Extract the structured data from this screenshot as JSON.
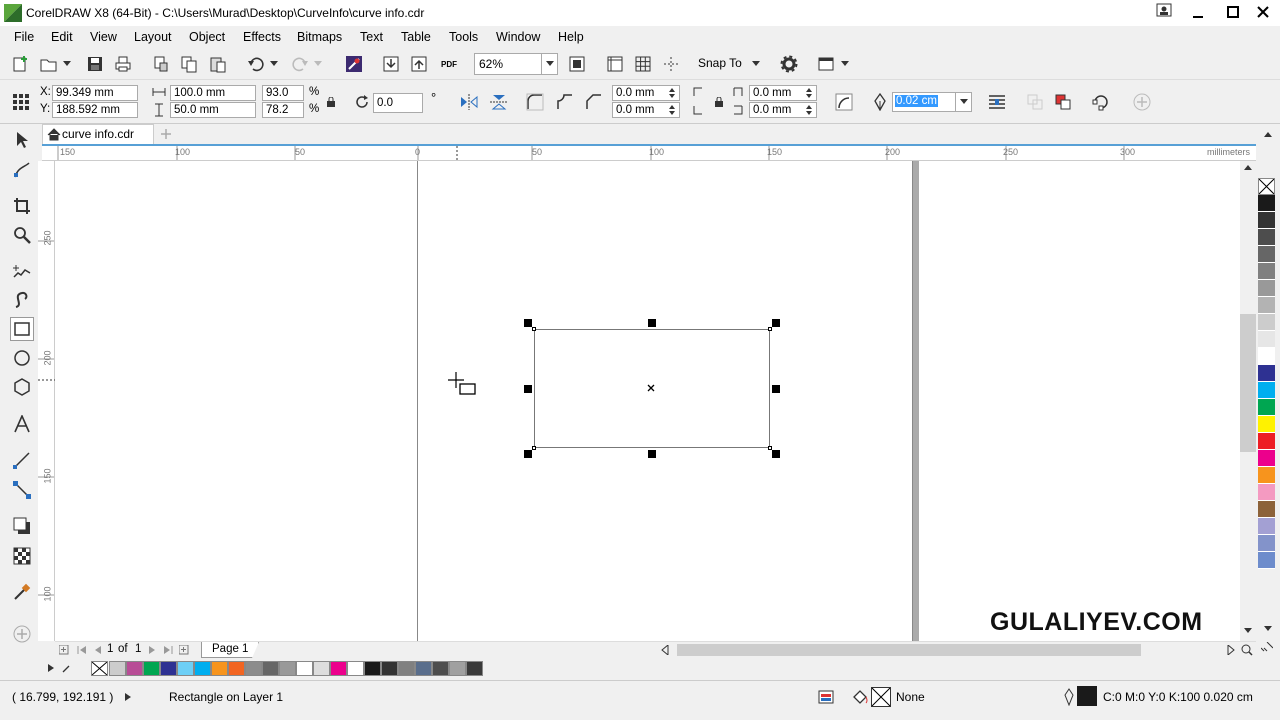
{
  "window": {
    "title": "CorelDRAW X8 (64-Bit) - C:\\Users\\Murad\\Desktop\\CurveInfo\\curve info.cdr",
    "controls": [
      "minimize-icon",
      "maximize-icon",
      "close-icon"
    ]
  },
  "menu": [
    "File",
    "Edit",
    "View",
    "Layout",
    "Object",
    "Effects",
    "Bitmaps",
    "Text",
    "Table",
    "Tools",
    "Window",
    "Help"
  ],
  "toolbar": {
    "zoom_level": "62%",
    "snap_to_label": "Snap To",
    "pdf_label": "PDF"
  },
  "property_bar": {
    "x_label": "X:",
    "x_value": "99.349 mm",
    "y_label": "Y:",
    "y_value": "188.592 mm",
    "width_value": "100.0 mm",
    "height_value": "50.0 mm",
    "scale_x": "93.0",
    "scale_y": "78.2",
    "percent_symbol": "%",
    "rotation": "0.0",
    "rotation_unit": "°",
    "corner_top_left": "0.0 mm",
    "corner_bottom_left": "0.0 mm",
    "corner_top_right": "0.0 mm",
    "corner_bottom_right": "0.0 mm",
    "outline_width": "0.02 cm"
  },
  "document_tab": {
    "label": "curve info.cdr",
    "add_icon": "plus-icon"
  },
  "ruler": {
    "units": "millimeters",
    "h_ticks": [
      "150",
      "100",
      "50",
      "0",
      "50",
      "100",
      "150",
      "200",
      "250",
      "300"
    ],
    "v_ticks": [
      "250",
      "200",
      "150",
      "100"
    ]
  },
  "page_nav": {
    "current": "1",
    "of_label": "of",
    "total": "1",
    "page_tab": "Page 1"
  },
  "status": {
    "cursor_coords": "( 16.799, 192.191 )",
    "object_info": "Rectangle on Layer 1",
    "fill_label": "None",
    "outline_info": "C:0 M:0 Y:0 K:100  0.020 cm"
  },
  "watermark": "GULALIYEV.COM",
  "colors": {
    "palette_vertical": [
      "#1a1a1a",
      "#333333",
      "#4d4d4d",
      "#666666",
      "#808080",
      "#999999",
      "#b3b3b3",
      "#cccccc",
      "#e6e6e6",
      "#ffffff",
      "#2e3192",
      "#00aeef",
      "#00a651",
      "#fff200",
      "#ed1c24",
      "#ec008c",
      "#f7941d",
      "#f49ac1",
      "#8c6239",
      "#a3a0d3",
      "#8393ca",
      "#6d8ccc"
    ],
    "palette_document": [
      "#cccccc",
      "#b84d96",
      "#00a651",
      "#2e3192",
      "#6dcff6",
      "#00aeef",
      "#f7941d",
      "#f26522",
      "#8c8c8c",
      "#666666",
      "#999999",
      "#ffffff",
      "#dddddd",
      "#ec008c",
      "#ffffff",
      "#1a1a1a",
      "#333333",
      "#808080",
      "#5a6e8c",
      "#4d4d4d",
      "#a0a0a0",
      "#3a3a3a"
    ],
    "accent": "#57a0d6",
    "selection_highlight": "#3399ff"
  }
}
